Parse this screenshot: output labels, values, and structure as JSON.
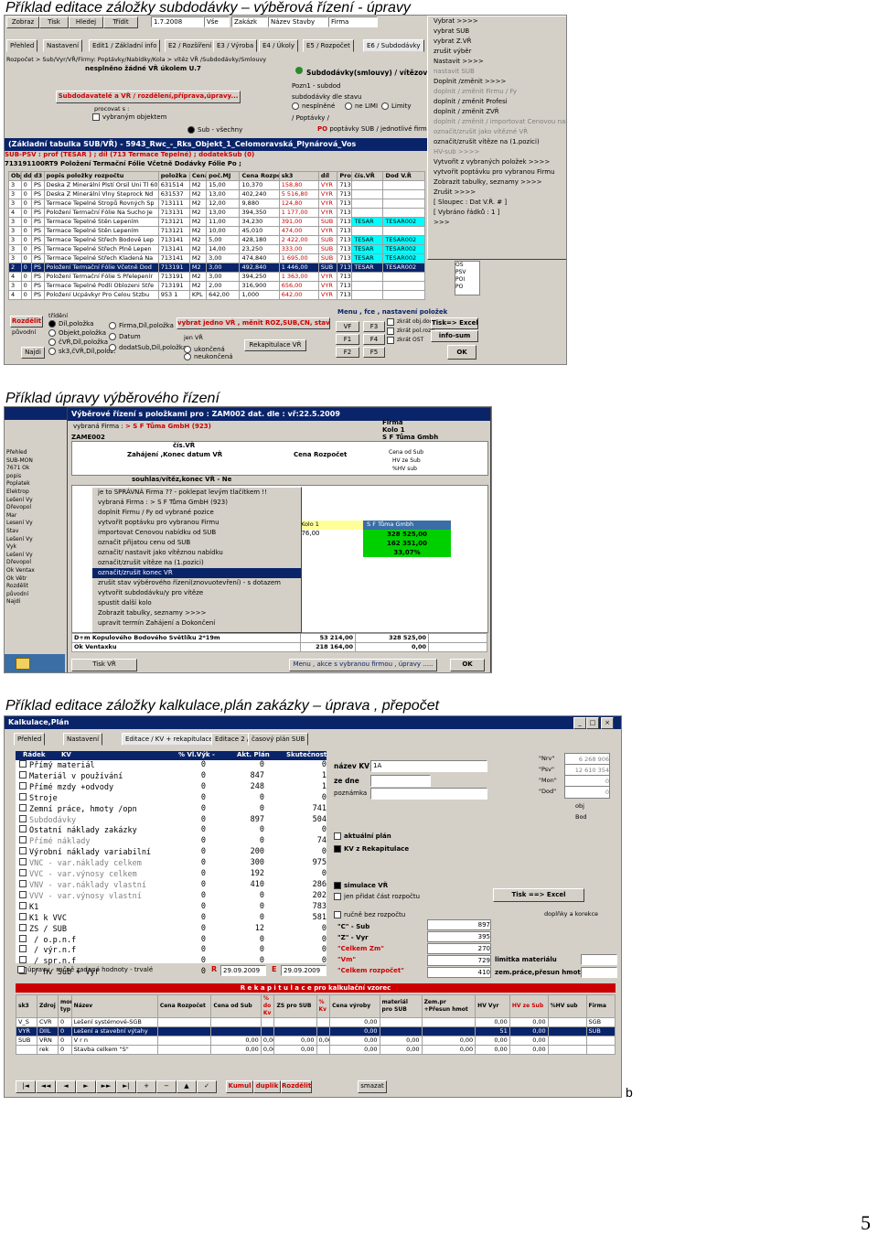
{
  "captions": [
    "Příklad editace záložky subdodávky – výběrová řízení - úpravy",
    "Příklad úpravy výběrového řízení",
    "Příklad editace záložky kalkulace,plán zakázky – úprava , přepočet"
  ],
  "side_letter": "b",
  "page_number": "5",
  "shot1": {
    "toolbar_buttons": [
      "Zobraz",
      "Tisk",
      "Hledej",
      "Třídit"
    ],
    "date_field": "1.7.2008",
    "filter_all": "Vše",
    "filter_zakaz": "Zakázk",
    "filter_stavby": "Název Stavby",
    "filter_firma": "Firma",
    "tabs": [
      "Přehled",
      "Nastavení",
      "Edit1 / Základní info",
      "E2 / Rozšíření",
      "E3 / Výroba",
      "E4 / Úkoly",
      "E5 / Rozpočet",
      "E6 / Subdodávky"
    ],
    "path": "Rozpočet > Sub/Vyr/VŘ/Firmy: Poptávky/Nabídky/Kola > vítěz VŘ /Subdodávky/Smlouvy",
    "warning": "nesplněno žádné VŘ úkolem  U.7",
    "sub_title": "Subdodávky(smlouvy) / vítězov",
    "header_btn": "Subdodavatelé a VŘ / rozdělení,příprava,úpravy...",
    "processing": "procovat s :",
    "opt1": "vybraným objektem",
    "opt2": "Sub - všechny",
    "info_bar": "(Základní tabulka SUB/VŘ) - 5943_Rwc_-_Rks_Objekt_1_Celomoravská_Plynárová_Vos",
    "info_line2": "SUB-PSV : prof (TESAR ) ; díl (713 Termace Tepelné) ; dodatekSub (0)",
    "info_line3": "713191100RT9 Položení Termační Fólie Včetně Dodávky Fólie Po ;",
    "grid_headers": [
      "Obj",
      "dd",
      "d3",
      "popis položky rozpočtu",
      "položka rozpočtu",
      "Cena/Mj",
      "poč.MJ",
      "Cena Rozpočet",
      "sk3",
      "díl",
      "Prof",
      "čís.VŘ",
      "Dod V.Ř"
    ],
    "grid_rows": [
      [
        "3",
        "0",
        "PS",
        "Deska Z Minerální Plstí Orsil Uni Tl 60",
        "631514",
        "M2",
        "15,00",
        "10,370",
        "158,80",
        "VYR",
        "713",
        "",
        ""
      ],
      [
        "3",
        "0",
        "PS",
        "Deska Z Minerální Vlny Steprock Nd",
        "631537",
        "M2",
        "13,00",
        "402,240",
        "5 516,80",
        "VYR",
        "713",
        "",
        ""
      ],
      [
        "3",
        "0",
        "PS",
        "Termace Tepelné Stropů Rovných Sp",
        "713111",
        "M2",
        "12,00",
        "9,880",
        "124,80",
        "VYR",
        "713",
        "",
        ""
      ],
      [
        "4",
        "0",
        "PS",
        "Položení Termační Fólie Na Sucho Je",
        "713131",
        "M2",
        "13,00",
        "394,350",
        "1 177,00",
        "VYR",
        "713",
        "",
        ""
      ],
      [
        "3",
        "0",
        "PS",
        "Termace Tepelné Stěn Lepením",
        "713121",
        "M2",
        "11,00",
        "34,230",
        "391,00",
        "SUB",
        "713",
        "TESAR",
        "TESAR002"
      ],
      [
        "3",
        "0",
        "PS",
        "Termace Tepelné Stěn Lepením",
        "713121",
        "M2",
        "10,00",
        "45,010",
        "474,00",
        "VYR",
        "713",
        "",
        ""
      ],
      [
        "3",
        "0",
        "PS",
        "Termace Tepelné Střech Bodově Lep",
        "713141",
        "M2",
        "5,00",
        "428,180",
        "2 422,00",
        "SUB",
        "713",
        "TESAR",
        "TESAR002"
      ],
      [
        "3",
        "0",
        "PS",
        "Termace Tepelné Střech Plně Lepen",
        "713141",
        "M2",
        "14,00",
        "23,250",
        "333,00",
        "SUB",
        "713",
        "TESAR",
        "TESAR002"
      ],
      [
        "3",
        "0",
        "PS",
        "Termace Tepelné Střech Kladená Na",
        "713141",
        "M2",
        "3,00",
        "474,840",
        "1 695,00",
        "SUB",
        "713",
        "TESAR",
        "TESAR002"
      ],
      [
        "2",
        "0",
        "PS",
        "Položení Termační Fólie Včetně Dod",
        "713191",
        "M2",
        "3,00",
        "492,840",
        "1 446,00",
        "SUB",
        "713",
        "TESAR",
        "TESAR002"
      ],
      [
        "4",
        "0",
        "PS",
        "Položení Termační Fólie S Přelepenír",
        "713191",
        "M2",
        "3,00",
        "394,250",
        "1 363,00",
        "VYR",
        "713",
        "",
        ""
      ],
      [
        "3",
        "0",
        "PS",
        "Termace Tepelné Podlí Oblozeni Stře",
        "713191",
        "M2",
        "2,00",
        "316,900",
        "656,00",
        "VYR",
        "713",
        "",
        ""
      ],
      [
        "4",
        "0",
        "PS",
        "Položení Ucpávkyr Pro Celou Stzbu",
        "953 1",
        "KPL",
        "642,00",
        "1,000",
        "642,00",
        "VYR",
        "713",
        "",
        ""
      ]
    ],
    "right_form": {
      "poznl": "Pozn1 - subdod",
      "subdodavky_dle": "subdodávky dle stavu",
      "opt_nesplnene": "nesplněné",
      "opt_nelimi": "ne LIMI",
      "opt_limity": "Limity",
      "poptavky": "/ Poptávky /",
      "po_label": "PO",
      "po_text": "poptávky SUB / jednotlivé firmy na"
    },
    "context_menu": [
      {
        "t": "Vybrat     >>>>",
        "c": ""
      },
      {
        "t": "vybrat SUB",
        "c": ""
      },
      {
        "t": "vybrat Z.VŘ",
        "c": ""
      },
      {
        "t": "zrušit výběr",
        "c": ""
      },
      {
        "t": "Nastavit    >>>>",
        "c": ""
      },
      {
        "t": "nastavit SUB",
        "c": "dis"
      },
      {
        "t": "Doplnit /změnit   >>>>",
        "c": ""
      },
      {
        "t": "doplnit / změnit   Firmu / Fy",
        "c": "dis"
      },
      {
        "t": "doplnit / změnit   Profesi",
        "c": ""
      },
      {
        "t": "doplnit / změnit   ZVŘ",
        "c": ""
      },
      {
        "t": "doplnit / změnit / importovat Cenovou nabídku",
        "c": "dis"
      },
      {
        "t": "označit/zrušit  jako vítězné VŘ",
        "c": "dis"
      },
      {
        "t": "označit/zrušit  vítěze na (1.pozici)",
        "c": ""
      },
      {
        "t": "HV-sub    >>>>",
        "c": "dis"
      },
      {
        "t": "Vytvořit z vybraných položek  >>>>",
        "c": ""
      },
      {
        "t": "vytvořit poptávku pro vybranou Firmu",
        "c": ""
      },
      {
        "t": "Zobrazit  tabulky, seznamy  >>>>",
        "c": ""
      },
      {
        "t": "Zrušit          >>>>",
        "c": ""
      },
      {
        "t": "[ Sloupec : Dat V.Ř.  #  ]",
        "c": ""
      },
      {
        "t": "[ Vybráno řádků : 1 ]",
        "c": ""
      },
      {
        "t": ">>>",
        "c": ""
      }
    ],
    "bottom": {
      "rozdelit": "Rozdělit",
      "puvodni": "původní",
      "najdi": "Najdi",
      "trideni": "třídění",
      "radio1": "Díl,položka",
      "radio2": "Objekt,položka",
      "radio3": "čVŘ,Díl,položka",
      "radio4": "sk3,čVŘ,Díl,polož.",
      "radio5": "Firma,Díl,položka",
      "radio6": "Datum",
      "radio7": "dodatSub,Díl,položka",
      "vybrat": "vybrat jedno VŘ ,  měnit ROZ,SUB,CN,  stav VŘ",
      "jen_vr": "jen VŘ",
      "ukoncena": "ukončená",
      "neukoncena": "neukončená",
      "rekap": "Rekapitulace VŘ",
      "menu_fce": "Menu , fce , nastavení položek",
      "vf": "VF",
      "f1": "F1",
      "f2": "F2",
      "f3": "F3",
      "f4": "F4",
      "f5": "F5",
      "zkr1": "zkrát obj.dod",
      "zkr2": "zkrát pol.rozp",
      "zkr3": "zkrát OST",
      "tisk_excel": "Tisk=> Excel",
      "info_sum": "info-sum",
      "ok": "OK"
    }
  },
  "shot2": {
    "title": "Výběrové řízení s položkami pro : ZAM002 dat. dle : vř:22.5.2009",
    "vybrana_firma": "vybraná Firma :",
    "firma_value": "> S F Tůma GmbH (923)",
    "zakazka": "ZAME002",
    "hdr_zahajeni": "Zahájení ,Konec datum VŘ",
    "hdr_cena": "Cena Rozpočet",
    "hdr_firma": "Firma",
    "firma_kolo": "Kolo 1",
    "firma_name": "S F Tůma Gmbh",
    "cis_vr": "čís.VŘ",
    "cena_od_sub": "Cena od Sub",
    "hv_sub": "HV ze Sub",
    "pct_hv": "%HV sub",
    "souhlas": "souhlas/vítěz,konec VŘ - Ne",
    "menu": [
      {
        "t": "je to SPRÁVNÁ Firma ?? - poklepat levým tlačítkem  !!",
        "c": ""
      },
      {
        "t": "vybraná Firma :      > S F Tůma GmbH (923)",
        "c": ""
      },
      {
        "t": "doplnit   Firmu / Fy  od vybrané pozice",
        "c": ""
      },
      {
        "t": "vytvořit poptávku  pro vybranou Firmu",
        "c": ""
      },
      {
        "t": "importovat Cenovou nabídku od SUB",
        "c": ""
      },
      {
        "t": "označit přijatou cenu od SUB",
        "c": ""
      },
      {
        "t": "označit/ nastavit jako vítěznou nabídku",
        "c": ""
      },
      {
        "t": "označit/zrušit  vítěze na (1.pozici)",
        "c": ""
      },
      {
        "t": "označit/zrušit   konec VŘ",
        "c": "sel"
      },
      {
        "t": "zrušit stav výběrového řízení(znovuotevření) - s dotazem",
        "c": ""
      },
      {
        "t": "vytvořit subdodávku/y pro vítěze",
        "c": ""
      },
      {
        "t": "spustit další kolo",
        "c": ""
      },
      {
        "t": "Zobrazit  tabulky, seznamy  >>>>",
        "c": ""
      },
      {
        "t": "upravit  termín   Zahájení a Dokončení",
        "c": ""
      }
    ],
    "kolo_label": "Kolo 1",
    "kolo_firma": "S F Tůma Gmbh",
    "green_values": [
      "328 525,00",
      "162 351,00",
      "33,07%"
    ],
    "sum_left": "876,00",
    "bottom_rows": [
      [
        "D+m Kopulového Bodového Světlíku  2*19m",
        "53 214,00",
        "328 525,00"
      ],
      [
        "Ok Ventaxku",
        "218 164,00",
        "0,00"
      ]
    ],
    "tisk_vr": "Tisk VŘ",
    "menu_akce": "Menu , akce s vybranou firmou , úpravy .....",
    "ok": "OK",
    "left_items": [
      "Přehled",
      "SUB-MON",
      "7671 Ok",
      "popis",
      "Poplatek",
      "Elektrop",
      "Lešení Vy",
      "Dřevopol",
      "Mar",
      "Lesení Vy",
      "Stav",
      "Lešení Vy",
      "Vyk",
      "Lešení Vy",
      "Dřevopol",
      "Ok Ventax",
      "Ok Větr",
      "Rozdělit",
      "původní",
      "Najdi"
    ],
    "left_cols": [
      "Sbo"
    ]
  },
  "shot3": {
    "title": "Kalkulace,Plán",
    "tabs": [
      "Přehled",
      "Nastavení",
      "Editace / KV + rekapitulace",
      "Editace 2 /",
      "časový  plán  SUB"
    ],
    "list_headers": [
      "Řádek",
      "KV",
      "% Vl.Výk -",
      "Akt. Plán",
      "Skutečnost"
    ],
    "list_rows": [
      [
        "Přímý materiál",
        "0",
        "0",
        "0"
      ],
      [
        "Materiál v používání",
        "0",
        "847",
        "1"
      ],
      [
        "Přímé mzdy +odvody",
        "0",
        "248",
        "1"
      ],
      [
        "Stroje",
        "0",
        "0",
        "0"
      ],
      [
        "Zemní práce, hmoty /opn",
        "0",
        "0",
        "741"
      ],
      [
        "Subdodávky",
        "0",
        "897",
        "504"
      ],
      [
        "Ostatní náklady zakázky",
        "0",
        "0",
        "0"
      ],
      [
        "Přímé náklady",
        "0",
        "0",
        "74"
      ],
      [
        "Výrobní náklady variabilní",
        "0",
        "200",
        "0"
      ],
      [
        "VNC - var.náklady celkem",
        "0",
        "300",
        "975"
      ],
      [
        "VVC - var.výnosy  celkem",
        "0",
        "192",
        "0"
      ],
      [
        "VNV - var.náklady vlastní",
        "0",
        "410",
        "286"
      ],
      [
        "VVV - var.výnosy  vlastní",
        "0",
        "0",
        "202"
      ],
      [
        "K1",
        "0",
        "0",
        "783"
      ],
      [
        "K1 k VVC",
        "0",
        "0",
        "581"
      ],
      [
        "ZS / SUB",
        "0",
        "12",
        "0"
      ],
      [
        "   / o.p.n.f",
        "0",
        "0",
        "0"
      ],
      [
        "   / výr.n.f",
        "0",
        "0",
        "0"
      ],
      [
        "   / spr.n.f",
        "0",
        "0",
        "0"
      ],
      [
        "   / hv Sub + Vyr",
        "0",
        "0",
        "0"
      ]
    ],
    "rucne": "úpravy - ručně zadané hodnoty - trvalé",
    "r_label": "R",
    "e_label": "E",
    "date1": "29.09.2009",
    "date2": "29.09.2009",
    "nazev_kv": "název KV",
    "nazev_value": "1A",
    "ze_dne": "ze dne",
    "poznamka": "poznámka",
    "right_labels": [
      "\"Nrv\"",
      "\"Psv\"",
      "\"Mon\"",
      "\"Dod\""
    ],
    "right_values": [
      "6 268 906",
      "12 610 354",
      "0",
      "0"
    ],
    "obj": "obj",
    "bod": "Bod",
    "aktualni_plan": "aktuální plán",
    "kv_z_rekap": "KV z Rekapitulace",
    "simulace": "simulace VŘ",
    "jen_pridat": "jen přidat část rozpočtu",
    "tisk_excel": "Tisk ==> Excel",
    "rucne_rozpocet": "ručně bez rozpočtu",
    "doplnky": "doplňky a korekce",
    "c_sub": "\"C\" - Sub",
    "z_vyr": "\"Z\" - Vyr",
    "celkem_zm": "\"Celkem Zm\"",
    "vm": "\"Vm\"",
    "celkem_rozpocet": "\"Celkem rozpočet\"",
    "c_values": [
      "897",
      "395",
      "270",
      "729",
      "410"
    ],
    "limitka": "limitka materiálu",
    "zem_prace": "zem.práce,přesun hmot",
    "rekap_title": "R e k a p i t u l a c e    pro kalkulační vzorec",
    "rekap_headers": [
      "sk3",
      "Zdroj",
      "mor typ",
      "Název",
      "Cena Rozpočet",
      "Cena od Sub",
      "% do Kv",
      "ZS pro SUB",
      "% Kv",
      "Cena výroby",
      "materiál pro SUB",
      "Zem.pr +Přesun hmot",
      "HV Vyr",
      "HV ze Sub",
      "%HV sub",
      "Firma"
    ],
    "rekap_rows": [
      [
        "V_S",
        "CVR",
        "0",
        "Lešení systémové-SGB",
        "",
        "",
        "",
        "",
        "",
        "0,00",
        "",
        "",
        "0,00",
        "0,00",
        "",
        "SGB"
      ],
      [
        "VYR",
        "DIIL",
        "0",
        "Lešení a stavební výtahy",
        "",
        "",
        "",
        "",
        "",
        "0,00",
        "",
        "",
        "51",
        "0,00",
        "",
        "SUB"
      ],
      [
        "SUB",
        "VRN",
        "0",
        "V r n",
        "",
        "0,00",
        "0,00",
        "0,00",
        "0,00",
        "0,00",
        "0,00",
        "0,00",
        "0,00",
        "0,00",
        "",
        ""
      ],
      [
        "",
        "rek",
        "0",
        "Stavba celkem \"S\"",
        "",
        "0,00",
        "0,00",
        "0,00",
        "",
        "0,00",
        "0,00",
        "0,00",
        "0,00",
        "0,00",
        "",
        ""
      ]
    ],
    "nav": [
      "|◄",
      "◄◄",
      "◄",
      "►",
      "►►",
      "►|",
      "+",
      "−",
      "▲",
      "✓",
      "✗",
      "C"
    ],
    "kumul": "Kumul",
    "duplik": "duplik",
    "rozdelit": "Rozdělit",
    "smazat": "smazat"
  },
  "colors": {
    "titlebar": "#0a246a",
    "window": "#d4d0c8",
    "selection_cyan": "#00ffff",
    "green": "#00d000",
    "red_text": "#cc0000"
  }
}
